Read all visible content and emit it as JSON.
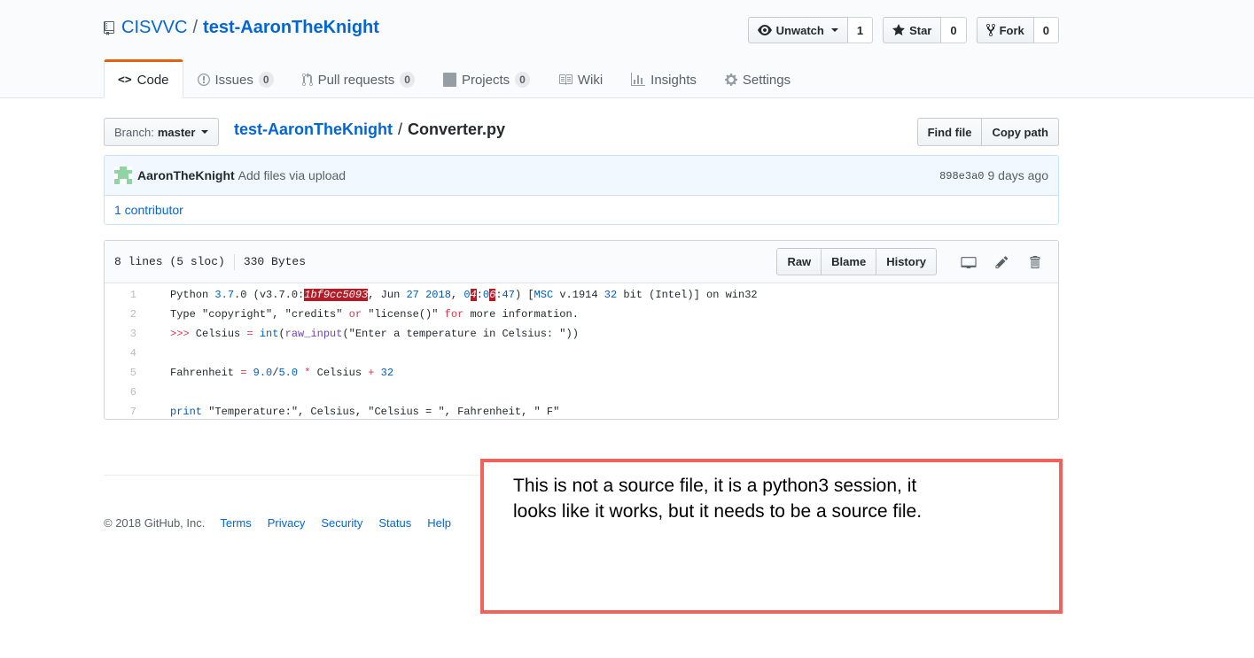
{
  "repo": {
    "owner": "CISVVC",
    "separator": "/",
    "name": "test-AaronTheKnight"
  },
  "actions": {
    "watch_label": "Unwatch",
    "watch_count": "1",
    "star_label": "Star",
    "star_count": "0",
    "fork_label": "Fork",
    "fork_count": "0"
  },
  "nav": {
    "code": "Code",
    "issues": "Issues",
    "issues_count": "0",
    "pulls": "Pull requests",
    "pulls_count": "0",
    "projects": "Projects",
    "projects_count": "0",
    "wiki": "Wiki",
    "insights": "Insights",
    "settings": "Settings"
  },
  "file_nav": {
    "branch_label": "Branch:",
    "branch_value": "master",
    "breadcrumb_root": "test-AaronTheKnight",
    "breadcrumb_sep": "/",
    "file_name": "Converter.py",
    "find_file": "Find file",
    "copy_path": "Copy path"
  },
  "commit": {
    "author": "AaronTheKnight",
    "message": "Add files via upload",
    "sha": "898e3a0",
    "time": "9 days ago",
    "contributors": "1 contributor"
  },
  "file": {
    "lines_info": "8 lines (5 sloc)",
    "size": "330 Bytes",
    "raw": "Raw",
    "blame": "Blame",
    "history": "History"
  },
  "footer": {
    "copyright": "© 2018 GitHub, Inc.",
    "links": [
      "Terms",
      "Privacy",
      "Security",
      "Status",
      "Help"
    ]
  },
  "annotation": {
    "line1": "This is not a source file, it is a python3 session, it",
    "line2": "looks like it works, but it needs to be a source file."
  },
  "colors": {
    "link": "#0366d6",
    "selected_tab_border": "#e36209",
    "annotation_border": "#f0625a",
    "commit_bg": "#f1f8ff",
    "error_highlight": "#b31d28"
  }
}
